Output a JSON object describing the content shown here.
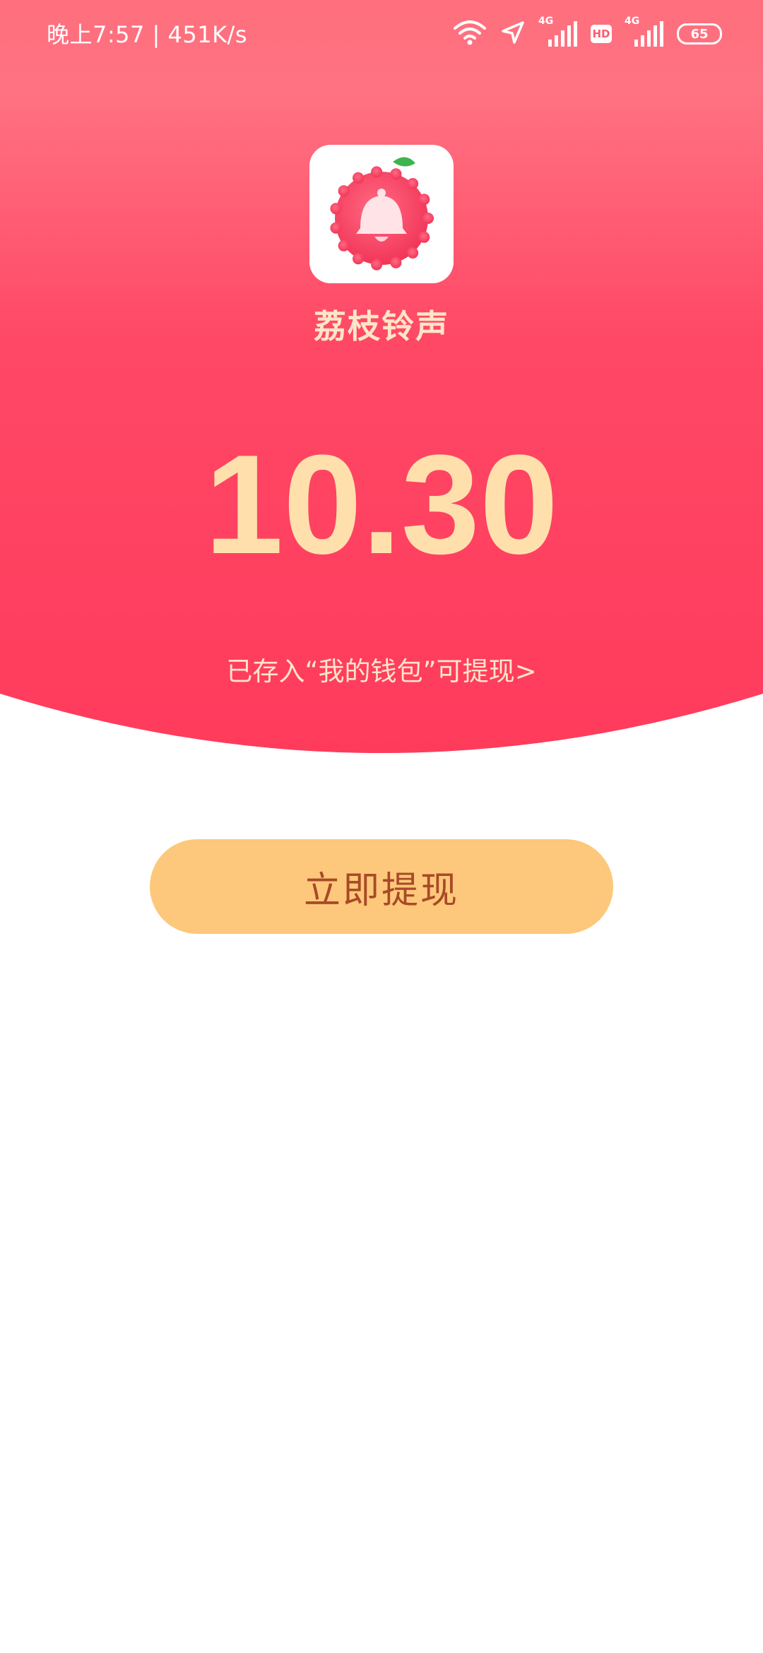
{
  "status_bar": {
    "time_speed": "晚上7:57 | 451K/s",
    "network_1": "4G",
    "network_2": "4G",
    "hd": "HD",
    "battery": "65",
    "icons": [
      "wifi-icon",
      "location-icon",
      "signal-icon",
      "hd-icon",
      "signal-icon",
      "battery-icon"
    ]
  },
  "app": {
    "name": "荔枝铃声",
    "icon": "lychee-bell-icon"
  },
  "reward": {
    "amount": "10.30",
    "wallet_link": "已存入“我的钱包”可提现>"
  },
  "actions": {
    "withdraw_label": "立即提现"
  },
  "colors": {
    "hero_top": "#ff6f7d",
    "hero_bottom": "#ff3f5f",
    "amount": "#ffe0ad",
    "button_bg": "#fdc87b",
    "button_text": "#a84a27",
    "background": "#ffffff"
  }
}
